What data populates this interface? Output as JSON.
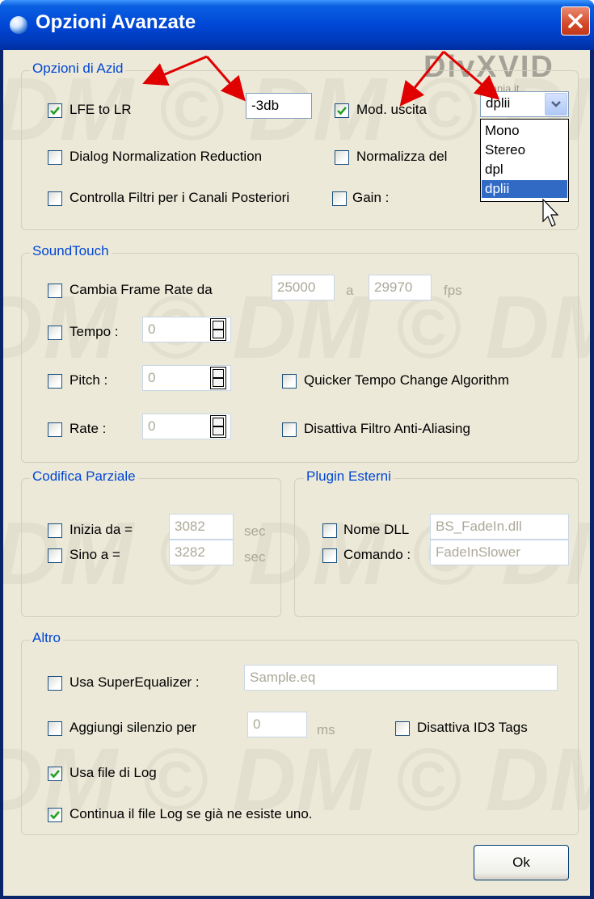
{
  "window": {
    "title": "Opzioni Avanzate"
  },
  "watermark": {
    "text": "DM © DM © DM ©",
    "logo_text": "DivXVID",
    "logo_sub": "mania.it"
  },
  "azid": {
    "legend": "Opzioni di Azid",
    "lfe_label": "LFE to LR",
    "lfe_checked": true,
    "lfe_value": "-3db",
    "mod_label": "Mod. uscita",
    "mod_checked": true,
    "mod_value": "dplii",
    "mod_options": [
      "Mono",
      "Stereo",
      "dpl",
      "dplii"
    ],
    "dialog_norm_label": "Dialog Normalization Reduction",
    "normalizza_label": "Normalizza del",
    "filtri_label": "Controlla Filtri per i Canali Posteriori",
    "gain_label": "Gain :"
  },
  "soundtouch": {
    "legend": "SoundTouch",
    "frame_label": "Cambia Frame Rate da",
    "frame_from": "25000",
    "frame_sep": "a",
    "frame_to": "29970",
    "frame_unit": "fps",
    "tempo_label": "Tempo :",
    "tempo_value": "0",
    "pitch_label": "Pitch :",
    "pitch_value": "0",
    "rate_label": "Rate :",
    "rate_value": "0",
    "quicker_label": "Quicker Tempo Change Algorithm",
    "antialias_label": "Disattiva Filtro Anti-Aliasing"
  },
  "codifica": {
    "legend": "Codifica Parziale",
    "inizia_label": "Inizia da =",
    "inizia_value": "3082",
    "inizia_unit": "sec",
    "sino_label": "Sino a =",
    "sino_value": "3282",
    "sino_unit": "sec"
  },
  "plugin": {
    "legend": "Plugin Esterni",
    "dll_label": "Nome DLL",
    "dll_value": "BS_FadeIn.dll",
    "comando_label": "Comando :",
    "comando_value": "FadeInSlower"
  },
  "altro": {
    "legend": "Altro",
    "eq_label": "Usa SuperEqualizer :",
    "eq_value": "Sample.eq",
    "silenzio_label": "Aggiungi silenzio per",
    "silenzio_value": "0",
    "silenzio_unit": "ms",
    "id3_label": "Disattiva ID3 Tags",
    "log_label": "Usa file di Log",
    "log_checked": true,
    "continua_label": "Continua il file Log se già ne esiste uno.",
    "continua_checked": true
  },
  "buttons": {
    "ok": "Ok"
  },
  "colors": {
    "title_bar": "#0047d6",
    "face": "#ece9d8",
    "legend": "#0046d5",
    "check": "#21a121",
    "selection": "#316ac5",
    "annotation_arrows": "#e00000"
  }
}
